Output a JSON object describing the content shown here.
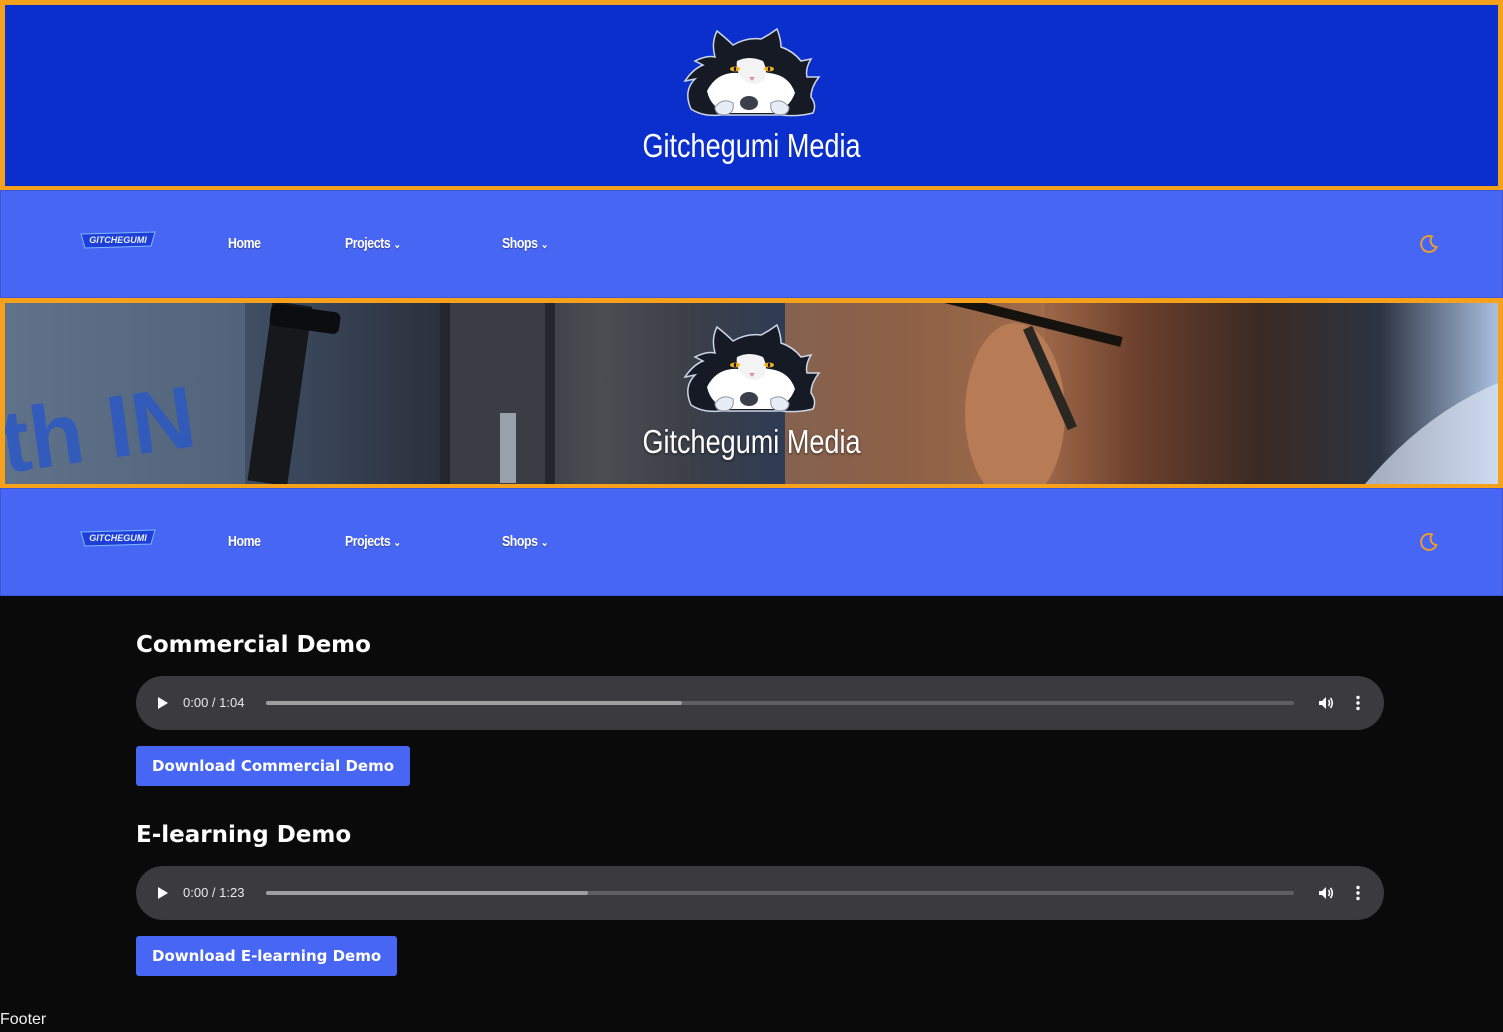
{
  "brand": {
    "title": "Gitchegumi Media",
    "nav_logo_text": "GITCHEGUMI"
  },
  "nav": {
    "items": [
      {
        "label": "Home",
        "has_dropdown": false
      },
      {
        "label": "Projects",
        "has_dropdown": true
      },
      {
        "label": "Shops",
        "has_dropdown": true
      }
    ],
    "theme_toggle_icon": "moon-icon"
  },
  "demos": [
    {
      "title": "Commercial Demo",
      "time": "0:00 / 1:04",
      "buffered_fraction": 0.405,
      "button": "Download Commercial Demo"
    },
    {
      "title": "E-learning Demo",
      "time": "0:00 / 1:23",
      "buffered_fraction": 0.313,
      "button": "Download E-learning Demo"
    }
  ],
  "footer": {
    "text": "Footer"
  },
  "colors": {
    "header_bg": "#0b2fcc",
    "nav_bg": "#4766f3",
    "accent_border": "#f6a11c",
    "page_bg": "#0a0a0b",
    "button_bg": "#4766f3"
  }
}
